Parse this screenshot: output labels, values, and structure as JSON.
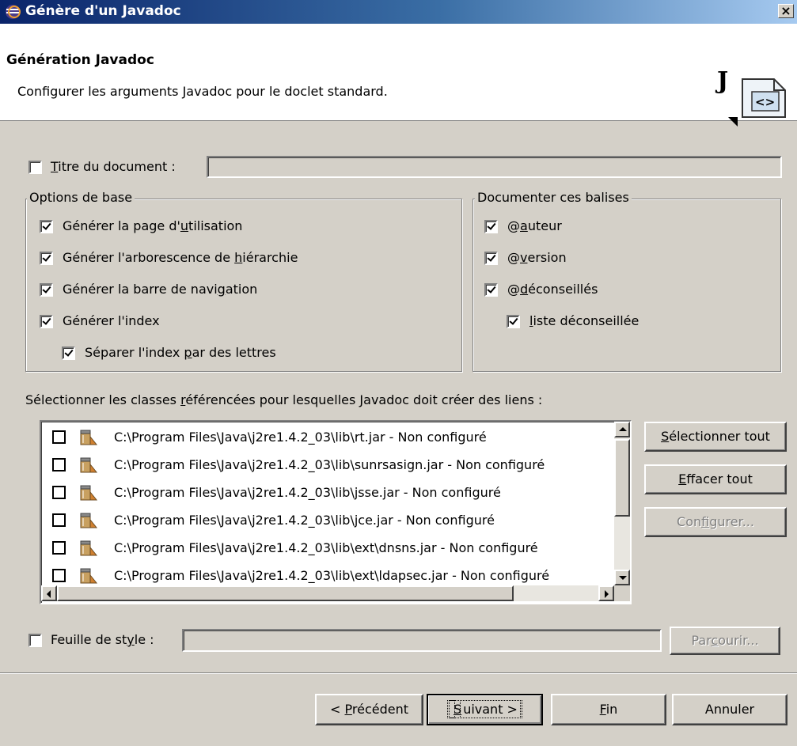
{
  "window": {
    "title": "Génère d'un Javadoc",
    "close_label": "×"
  },
  "header": {
    "title": "Génération Javadoc",
    "description": "Configurer les arguments Javadoc pour le doclet standard."
  },
  "document_title": {
    "label_pre": "",
    "label_ul": "T",
    "label_post": "itre du document :",
    "checked": false,
    "value": ""
  },
  "basic_options": {
    "legend": "Options de base",
    "items": [
      {
        "pre": "Générer la page d'",
        "ul": "u",
        "post": "tilisation",
        "checked": true
      },
      {
        "pre": "Générer l'arborescence de ",
        "ul": "h",
        "post": "iérarchie",
        "checked": true
      },
      {
        "pre": "Générer la barre de navi",
        "ul": "g",
        "post": "ation",
        "checked": true
      },
      {
        "pre": "Générer l'index",
        "ul": "",
        "post": "",
        "checked": true
      },
      {
        "pre": "Séparer l'index ",
        "ul": "p",
        "post": "ar des lettres",
        "checked": true
      }
    ]
  },
  "tags": {
    "legend": "Documenter ces balises",
    "items": [
      {
        "pre": "@",
        "ul": "a",
        "post": "uteur",
        "checked": true
      },
      {
        "pre": "@",
        "ul": "v",
        "post": "ersion",
        "checked": true
      },
      {
        "pre": "@",
        "ul": "d",
        "post": "éconseillés",
        "checked": true
      },
      {
        "pre": "",
        "ul": "l",
        "post": "iste déconseillée",
        "checked": true
      }
    ]
  },
  "referenced_classes": {
    "label_pre": "Sélectionner les classes ",
    "label_ul": "r",
    "label_post": "éférencées pour lesquelles Javadoc doit créer des liens :",
    "rows": [
      {
        "text": "C:\\Program Files\\Java\\j2re1.4.2_03\\lib\\rt.jar - Non configuré",
        "checked": false
      },
      {
        "text": "C:\\Program Files\\Java\\j2re1.4.2_03\\lib\\sunrsasign.jar - Non configuré",
        "checked": false
      },
      {
        "text": "C:\\Program Files\\Java\\j2re1.4.2_03\\lib\\jsse.jar - Non configuré",
        "checked": false
      },
      {
        "text": "C:\\Program Files\\Java\\j2re1.4.2_03\\lib\\jce.jar - Non configuré",
        "checked": false
      },
      {
        "text": "C:\\Program Files\\Java\\j2re1.4.2_03\\lib\\ext\\dnsns.jar - Non configuré",
        "checked": false
      },
      {
        "text": "C:\\Program Files\\Java\\j2re1.4.2_03\\lib\\ext\\ldapsec.jar - Non configuré",
        "checked": false
      }
    ],
    "buttons": {
      "select_all": {
        "ul": "S",
        "post": "électionner tout"
      },
      "clear_all": {
        "ul": "E",
        "post": "ffacer tout"
      },
      "configure": {
        "pre": "Con",
        "ul": "f",
        "post": "igurer..."
      }
    }
  },
  "stylesheet": {
    "label_pre": "Feuille de st",
    "label_ul": "y",
    "label_post": "le :",
    "checked": false,
    "value": "",
    "browse": {
      "pre": "Par",
      "ul": "c",
      "post": "ourir..."
    }
  },
  "footer": {
    "back": {
      "pre": "< ",
      "ul": "P",
      "post": "récédent"
    },
    "next": {
      "pre": "",
      "ul": "S",
      "post": "uivant >"
    },
    "finish": {
      "pre": "",
      "ul": "F",
      "post": "in"
    },
    "cancel": {
      "pre": "Annuler",
      "ul": "",
      "post": ""
    }
  },
  "colors": {
    "titlebar_start": "#0a246a",
    "titlebar_end": "#a6caf0",
    "dialog_bg": "#d4d0c8"
  }
}
